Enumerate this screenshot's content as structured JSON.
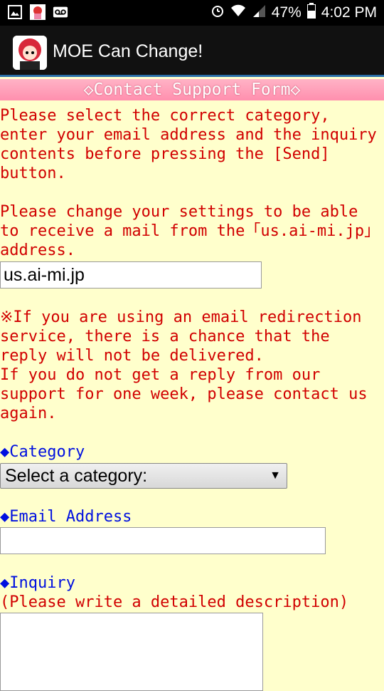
{
  "statusbar": {
    "battery": "47%",
    "time": "4:02 PM"
  },
  "app": {
    "title": "MOE Can Change!"
  },
  "form": {
    "header": "◇Contact Support Form◇",
    "intro": "Please select the correct category,\nenter your email address and the inquiry\ncontents before pressing the [Send]\nbutton.",
    "settings_note": "Please change your settings to be able\nto receive a mail from the「us.ai-mi.jp」\naddress.",
    "domain_value": "us.ai-mi.jp",
    "warning": "※If you are using an email redirection\nservice, there is a chance that the\nreply will not be delivered.\nIf you do not get a reply from our\nsupport for one week, please contact us\nagain.",
    "category_label": "◆Category",
    "category_selected": "Select a category:",
    "email_label": "◆Email Address",
    "email_value": "",
    "inquiry_label": "◆Inquiry",
    "inquiry_hint": "(Please write a detailed description)"
  }
}
